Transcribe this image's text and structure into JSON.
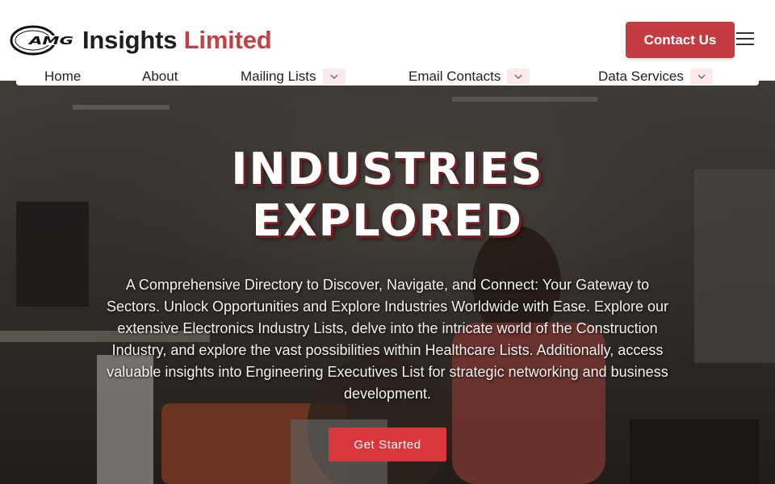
{
  "header": {
    "logo_mark_text": "AMG",
    "brand_insights": "Insights",
    "brand_limited": "Limited",
    "contact_label": "Contact Us"
  },
  "nav": {
    "items": [
      {
        "label": "Home",
        "has_dropdown": false
      },
      {
        "label": "About",
        "has_dropdown": false
      },
      {
        "label": "Mailing Lists",
        "has_dropdown": true
      },
      {
        "label": "Email Contacts",
        "has_dropdown": true
      },
      {
        "label": "Data Services",
        "has_dropdown": true
      }
    ]
  },
  "hero": {
    "title_line1": "INDUSTRIES",
    "title_line2": "EXPLORED",
    "description": "A Comprehensive Directory to Discover, Navigate, and Connect: Your Gateway to Sectors. Unlock Opportunities and Explore Industries Worldwide with Ease. Explore our extensive Electronics Industry Lists, delve into the intricate world of the Construction Industry, and explore the vast possibilities within Healthcare Lists. Additionally, access valuable insights into Engineering Executives List for strategic networking and business development.",
    "cta_label": "Get Started"
  },
  "colors": {
    "accent": "#c43b42",
    "cta": "#d8373d",
    "brand_limited": "#c24146",
    "caret_bg": "#fbe9ea"
  },
  "icons": {
    "menu": "hamburger-icon",
    "dropdown": "chevron-down-icon"
  }
}
